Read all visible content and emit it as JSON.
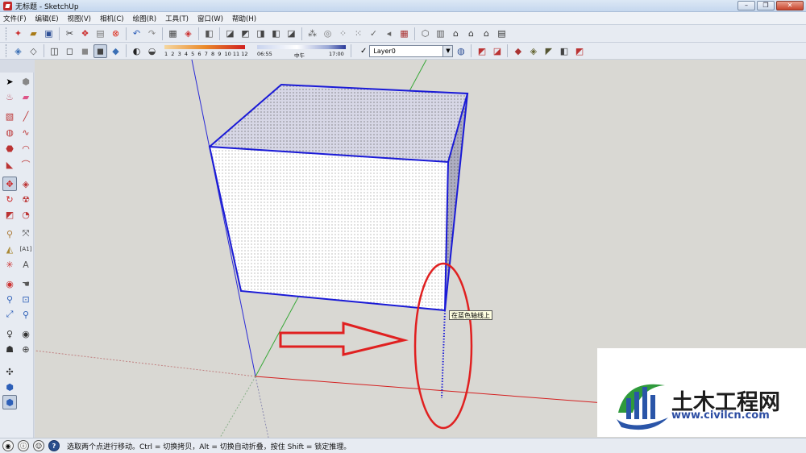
{
  "window": {
    "title": "无标题 - SketchUp",
    "controls": [
      "–",
      "❐",
      "✕"
    ]
  },
  "menu": [
    "文件(F)",
    "编辑(E)",
    "视图(V)",
    "相机(C)",
    "绘图(R)",
    "工具(T)",
    "窗口(W)",
    "帮助(H)"
  ],
  "toolbar1": {
    "icons": [
      "new-icon",
      "open-icon",
      "save-icon",
      "cut-icon",
      "copy-icon",
      "paste-icon",
      "erase-icon",
      "undo-icon",
      "redo-icon",
      "print-icon",
      "model-info-icon",
      "orbit-view-icon",
      "iso-view-icon",
      "top-view-icon",
      "front-view-icon",
      "right-view-icon",
      "back-view-icon",
      "left-view-icon",
      "bottom-view-icon",
      "warehouse-icon",
      "component-icon",
      "sandbox-icon",
      "extension-icon",
      "house-icon",
      "roof-icon",
      "stairs-icon",
      "wall-icon"
    ]
  },
  "toolbar2": {
    "style_icons": [
      "xray-icon",
      "back-edges-icon",
      "wireframe-icon",
      "hidden-line-icon",
      "shaded-icon",
      "shaded-texture-icon",
      "monochrome-icon",
      "shadows-icon",
      "fog-icon"
    ],
    "shadow": {
      "month_ticks": [
        "1",
        "2",
        "3",
        "4",
        "5",
        "6",
        "7",
        "8",
        "9",
        "10",
        "11",
        "12"
      ],
      "time_start": "06:55",
      "time_mid": "中午",
      "time_end": "17:00"
    },
    "layer": {
      "name": "Layer0",
      "current_check": "✓"
    },
    "section_icons": [
      "layer-manager-icon",
      "section-plane-icon",
      "section-display-icon",
      "section-cut-icon",
      "walk-icon",
      "position-camera-icon",
      "look-around-icon",
      "lock-icon"
    ]
  },
  "left_toolbar": {
    "rows": [
      [
        "select-icon",
        "component-icon"
      ],
      [
        "paint-bucket-icon",
        "eraser-icon"
      ],
      [
        "rectangle-icon",
        "line-icon"
      ],
      [
        "circle-icon",
        "freehand-icon"
      ],
      [
        "polygon-icon",
        "arc-icon"
      ],
      [
        "pie-icon",
        "arc3-icon"
      ],
      [
        "move-icon",
        "push-pull-icon"
      ],
      [
        "rotate-icon",
        "follow-me-icon"
      ],
      [
        "scale-icon",
        "offset-icon"
      ],
      [
        "tape-measure-icon",
        "dimension-icon"
      ],
      [
        "protractor-icon",
        "text-icon"
      ],
      [
        "axes-icon",
        "3d-text-icon"
      ],
      [
        "orbit-icon",
        "pan-icon"
      ],
      [
        "zoom-icon",
        "zoom-window-icon"
      ],
      [
        "zoom-extents-icon",
        "previous-icon"
      ],
      [
        "position-camera-icon",
        "look-around-icon"
      ],
      [
        "walk-icon",
        "section-plane-icon"
      ],
      [
        "orbit-nav-icon"
      ],
      [
        "sandbox-icon"
      ],
      [
        "smoove-icon"
      ]
    ]
  },
  "viewport": {
    "tooltip": "在蓝色轴线上",
    "background": "#d9d8d3",
    "edge_color": "#1a1ad6",
    "red_axis": "#d42020",
    "green_axis": "#38a838",
    "blue_axis": "#2a2ad6",
    "annotation_color": "#e02020"
  },
  "watermark": {
    "name": "土木工程网",
    "url": "www.civilcn.com"
  },
  "status": {
    "icons": [
      "geo-location-icon",
      "credits-icon",
      "user-icon",
      "help-icon"
    ],
    "text": "选取两个点进行移动。Ctrl = 切换拷贝，Alt = 切换自动折叠，按住 Shift = 锁定推理。"
  }
}
